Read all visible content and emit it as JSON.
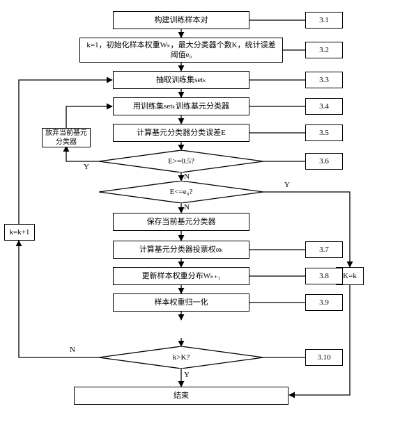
{
  "flow": {
    "n1": "构建训练样本对",
    "n2": "k=1，初始化样本权重Wₖ，最大分类器个数K，统计误差阈值e₀",
    "n3": "抽取训练集setₖ",
    "n4": "用训练集setₖ训练基元分类器",
    "n5": "计算基元分类器分类误差E",
    "d1": "E>=0.5?",
    "d2": "E<=e₀?",
    "n6": "保存当前基元分类器",
    "n7": "计算基元分类器投票权αₖ",
    "n8": "更新样本权重分布Wₖ₊₁",
    "n9": "样本权重归一化",
    "d3": "k>K?",
    "n10": "结束",
    "side_discard": "放弃当前基元分类器",
    "side_inc": "k=k+1",
    "side_setK": "K=k"
  },
  "refs": {
    "r1": "3.1",
    "r2": "3.2",
    "r3": "3.3",
    "r4": "3.4",
    "r5": "3.5",
    "r6": "3.6",
    "r7": "3.7",
    "r8": "3.8",
    "r9": "3.9",
    "r10": "3.10"
  },
  "labels": {
    "Y": "Y",
    "N": "N"
  }
}
